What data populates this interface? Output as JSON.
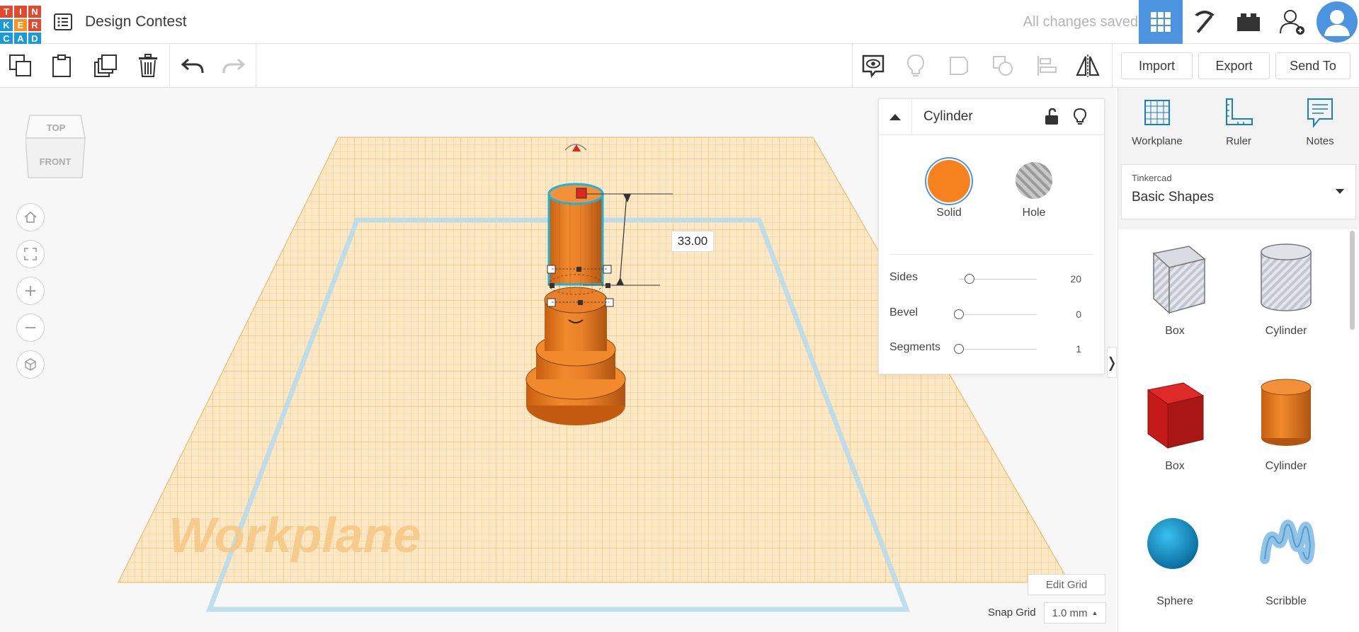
{
  "app": {
    "logo_letters": [
      "T",
      "I",
      "N",
      "K",
      "E",
      "R",
      "C",
      "A",
      "D"
    ],
    "logo_colors": [
      "#e4482f",
      "#e4482f",
      "#e4482f",
      "#1a9bd7",
      "#f7931e",
      "#e4482f",
      "#1a9bd7",
      "#1a9bd7",
      "#1a9bd7"
    ],
    "design_title": "Design Contest",
    "save_status": "All changes saved",
    "accent": "#4d94e0"
  },
  "toolbar": {
    "import_label": "Import",
    "export_label": "Export",
    "send_to_label": "Send To"
  },
  "canvas": {
    "viewcube_top": "TOP",
    "viewcube_front": "FRONT",
    "workplane_watermark": "Workplane",
    "dimension_value": "33.00",
    "edit_grid_label": "Edit Grid",
    "snap_grid_label": "Snap Grid",
    "snap_grid_value": "1.0 mm"
  },
  "inspector": {
    "shape_name": "Cylinder",
    "solid_label": "Solid",
    "hole_label": "Hole",
    "solid_color": "#f5821f",
    "properties": [
      {
        "label": "Sides",
        "value": "20",
        "fraction": 0.1
      },
      {
        "label": "Bevel",
        "value": "0",
        "fraction": 0
      },
      {
        "label": "Segments",
        "value": "1",
        "fraction": 0
      }
    ]
  },
  "right_panel": {
    "tools": [
      "Workplane",
      "Ruler",
      "Notes"
    ],
    "library_small": "Tinkercad",
    "library_name": "Basic Shapes",
    "shapes": [
      {
        "label": "Box",
        "icon": "box-hole-icon"
      },
      {
        "label": "Cylinder",
        "icon": "cylinder-hole-icon"
      },
      {
        "label": "Box",
        "icon": "box-red-icon"
      },
      {
        "label": "Cylinder",
        "icon": "cylinder-orange-icon"
      },
      {
        "label": "Sphere",
        "icon": "sphere-icon"
      },
      {
        "label": "Scribble",
        "icon": "scribble-icon"
      }
    ]
  }
}
